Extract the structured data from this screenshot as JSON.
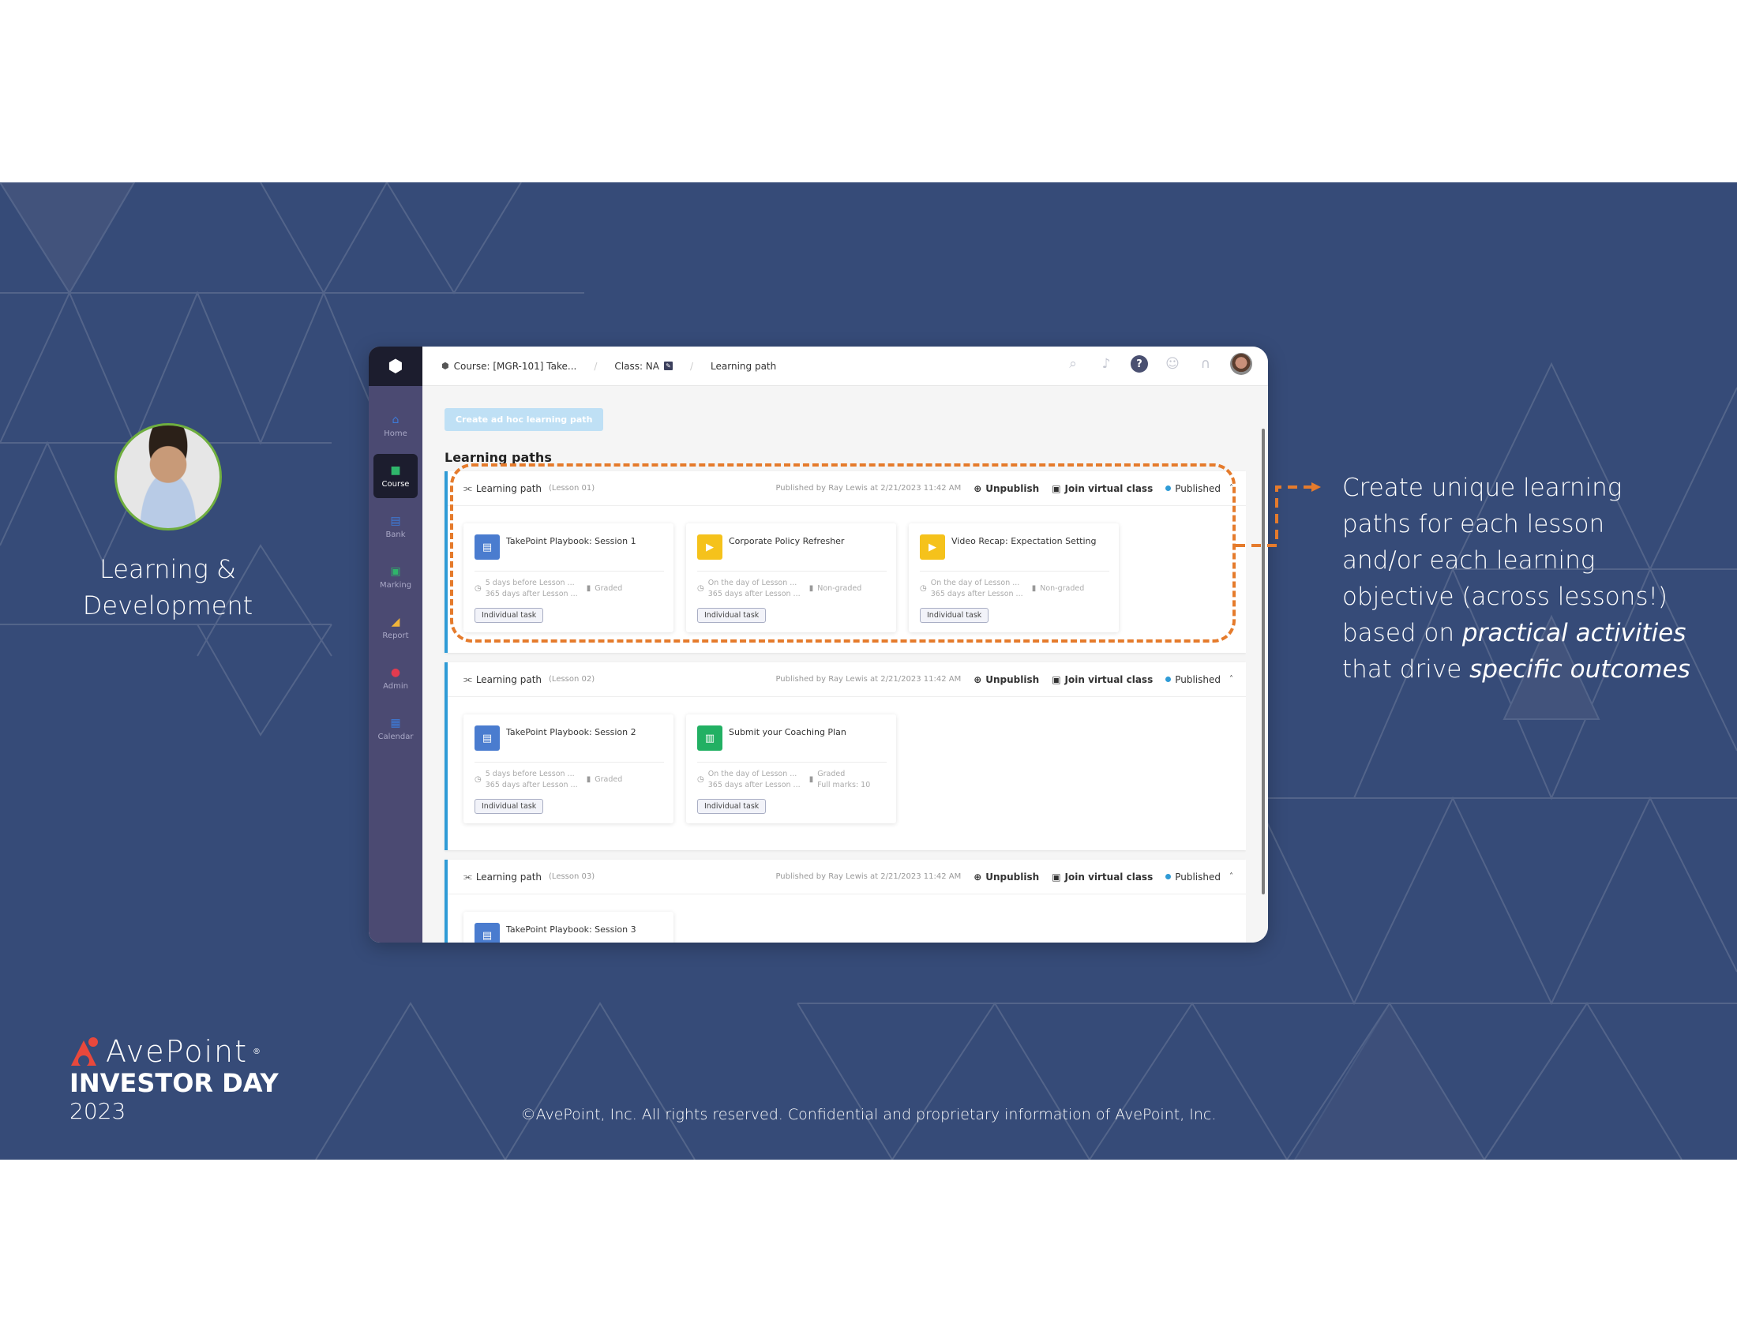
{
  "slide": {
    "persona_label_line1": "Learning &",
    "persona_label_line2": "Development",
    "callout": {
      "line1": "Create unique learning",
      "line2": "paths for each lesson",
      "line3": "and/or each learning",
      "line4": "objective (across lessons!)",
      "line5_prefix": "based on ",
      "line5_em": "practical activities",
      "line6_prefix": "that drive ",
      "line6_em": "specific outcomes"
    },
    "brand": {
      "name": "AvePoint",
      "registered": "®",
      "event": "INVESTOR DAY",
      "year": "2023"
    },
    "footer": "©AvePoint, Inc. All rights reserved. Confidential and proprietary information of AvePoint, Inc.",
    "colors": {
      "background": "#364b78",
      "highlight": "#e57b2c",
      "brand_red": "#e8483c"
    }
  },
  "app": {
    "sidebar": {
      "logo_icon": "box-logo-icon",
      "items": [
        {
          "label": "Home",
          "icon": "home-icon",
          "color": "#3d7bd9",
          "active": false
        },
        {
          "label": "Course",
          "icon": "cube-icon",
          "color": "#2fb66b",
          "active": true
        },
        {
          "label": "Bank",
          "icon": "bank-icon",
          "color": "#3d7bd9",
          "active": false
        },
        {
          "label": "Marking",
          "icon": "marking-icon",
          "color": "#2fb66b",
          "active": false
        },
        {
          "label": "Report",
          "icon": "report-icon",
          "color": "#f0b43a",
          "active": false
        },
        {
          "label": "Admin",
          "icon": "admin-icon",
          "color": "#e23b4f",
          "active": false
        },
        {
          "label": "Calendar",
          "icon": "calendar-icon",
          "color": "#3d7bd9",
          "active": false
        }
      ]
    },
    "breadcrumb": {
      "course": "Course: [MGR-101] Take...",
      "class": "Class: NA",
      "page": "Learning path"
    },
    "top_icons": [
      "search-icon",
      "bell-icon",
      "help-icon",
      "smile-icon",
      "headset-icon",
      "user-avatar"
    ],
    "create_button": "Create ad hoc learning path",
    "section_title": "Learning paths",
    "learning_paths": [
      {
        "title": "Learning path",
        "lesson": "(Lesson 01)",
        "published_by": "Published by Ray Lewis at 2/21/2023 11:42 AM",
        "unpublish": "Unpublish",
        "join": "Join virtual class",
        "status": "Published",
        "cards": [
          {
            "title": "TakePoint Playbook: Session 1",
            "type": "playbook",
            "sched1": "5 days before Lesson ...",
            "sched2": "365 days after Lesson ...",
            "grade": "Graded",
            "marks": "",
            "badge": "Individual task"
          },
          {
            "title": "Corporate Policy Refresher",
            "type": "video",
            "sched1": "On the day of Lesson ...",
            "sched2": "365 days after Lesson ...",
            "grade": "Non-graded",
            "marks": "",
            "badge": "Individual task"
          },
          {
            "title": "Video Recap: Expectation Setting",
            "type": "video",
            "sched1": "On the day of Lesson ...",
            "sched2": "365 days after Lesson ...",
            "grade": "Non-graded",
            "marks": "",
            "badge": "Individual task"
          }
        ]
      },
      {
        "title": "Learning path",
        "lesson": "(Lesson 02)",
        "published_by": "Published by Ray Lewis at 2/21/2023 11:42 AM",
        "unpublish": "Unpublish",
        "join": "Join virtual class",
        "status": "Published",
        "cards": [
          {
            "title": "TakePoint Playbook: Session 2",
            "type": "playbook",
            "sched1": "5 days before Lesson ...",
            "sched2": "365 days after Lesson ...",
            "grade": "Graded",
            "marks": "",
            "badge": "Individual task"
          },
          {
            "title": "Submit your Coaching Plan",
            "type": "document",
            "sched1": "On the day of Lesson ...",
            "sched2": "365 days after Lesson ...",
            "grade": "Graded",
            "marks": "Full marks: 10",
            "badge": "Individual task"
          }
        ]
      },
      {
        "title": "Learning path",
        "lesson": "(Lesson 03)",
        "published_by": "Published by Ray Lewis at 2/21/2023 11:42 AM",
        "unpublish": "Unpublish",
        "join": "Join virtual class",
        "status": "Published",
        "cards": [
          {
            "title": "TakePoint Playbook: Session 3",
            "type": "playbook",
            "sched1": "",
            "sched2": "",
            "grade": "",
            "marks": "",
            "badge": ""
          }
        ]
      }
    ],
    "card_type_colors": {
      "playbook": "#4a7ccf",
      "video": "#f5c21b",
      "document": "#22b063"
    }
  }
}
